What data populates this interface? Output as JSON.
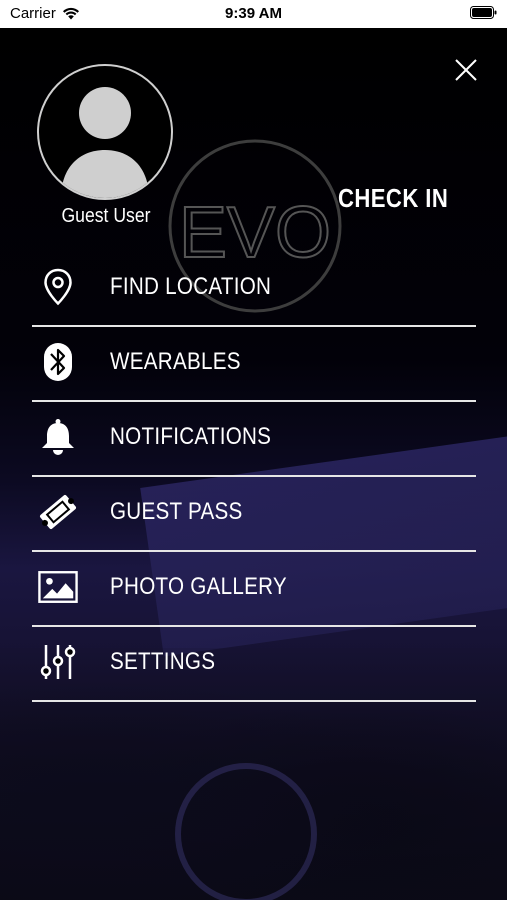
{
  "status_bar": {
    "carrier": "Carrier",
    "time": "9:39 AM",
    "icons": [
      "wifi-icon",
      "battery-icon"
    ]
  },
  "profile": {
    "name": "Guest User",
    "avatar_icon": "person-silhouette-icon"
  },
  "logo": {
    "text": "EVO"
  },
  "check_in": {
    "label": "CHECK IN"
  },
  "close_icon": "close-icon",
  "menu": [
    {
      "label": "FIND LOCATION",
      "icon": "location-pin-icon"
    },
    {
      "label": "WEARABLES",
      "icon": "bluetooth-icon"
    },
    {
      "label": "NOTIFICATIONS",
      "icon": "bell-icon"
    },
    {
      "label": "GUEST PASS",
      "icon": "ticket-icon"
    },
    {
      "label": "PHOTO GALLERY",
      "icon": "image-icon"
    },
    {
      "label": "SETTINGS",
      "icon": "sliders-icon"
    }
  ],
  "colors": {
    "background": "#000000",
    "text": "#ffffff",
    "divider": "#e6e6e6",
    "avatar_fill": "#cfcfcf"
  }
}
